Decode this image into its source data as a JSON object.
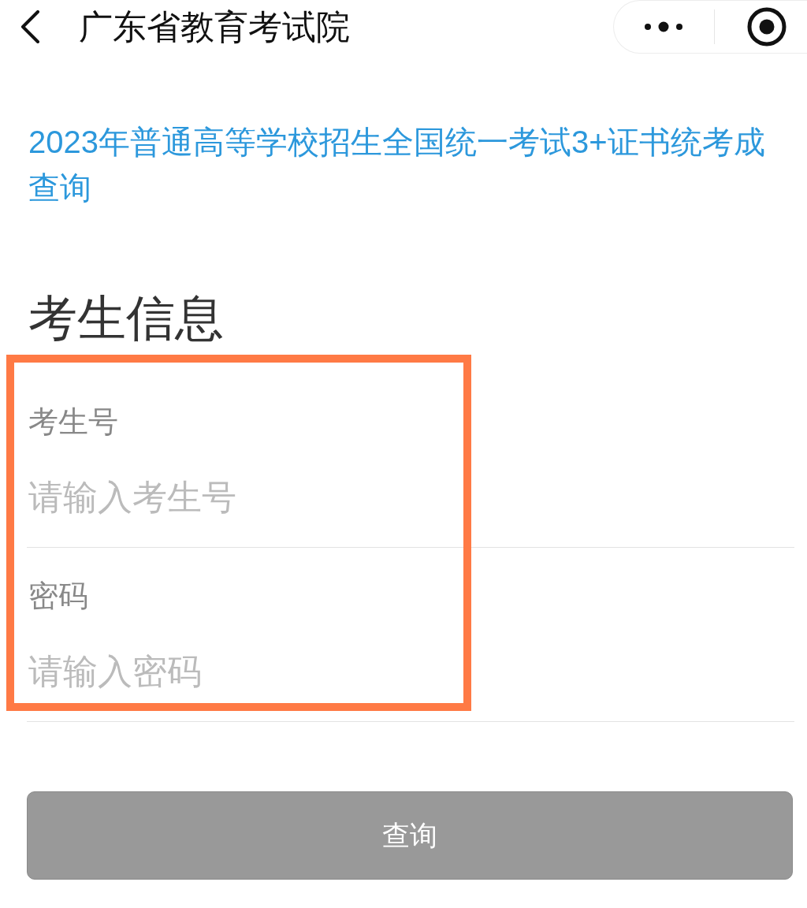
{
  "nav_bar": {
    "title": "广东省教育考试院"
  },
  "notice": {
    "title_lines": [
      "2023年普通高等学校招生全国统一考试3+证书统考成",
      "查询"
    ]
  },
  "section": {
    "heading": "考生信息"
  },
  "form": {
    "highlighted": true,
    "fields": [
      {
        "label": "考生号",
        "placeholder": "请输入考生号"
      },
      {
        "label": "密码",
        "placeholder": "请输入密码"
      }
    ]
  },
  "submit": {
    "label": "查询",
    "disabled": true
  }
}
